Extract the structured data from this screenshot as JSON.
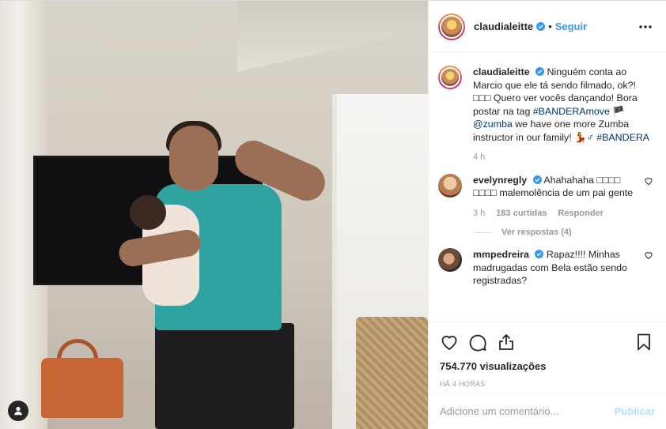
{
  "header": {
    "username": "claudialeitte",
    "separator": "•",
    "follow_label": "Seguir"
  },
  "caption": {
    "username": "claudialeitte",
    "text_1": "Ninguém conta ao Marcio que ele tá sendo filmado, ok?! □□□ Quero ver vocês dançando! Bora postar na tag ",
    "hashtag_1": "#BANDERAmove",
    "text_2": " 🏴 ",
    "mention": "@zumba",
    "text_3": " we have one more Zumba instructor in our family! 💃♂ ",
    "hashtag_2": "#BANDERA",
    "time": "4 h"
  },
  "comments": [
    {
      "username": "evelynregly",
      "text": "Ahahahaha □□□□ □□□□ malemolência de um pai gente",
      "time": "3 h",
      "likes": "183 curtidas",
      "reply_label": "Responder",
      "view_replies": "Ver respostas (4)"
    },
    {
      "username": "mmpedreira",
      "text": "Rapaz!!!! Minhas madrugadas com Bela estão sendo registradas?"
    }
  ],
  "stats": {
    "views": "754.770 visualizações",
    "time_ago": "HÁ 4 HORAS"
  },
  "composer": {
    "placeholder": "Adicione um comentário...",
    "post_label": "Publicar"
  },
  "colors": {
    "accent": "#3897f0",
    "hashtag": "#003569",
    "muted": "#999999"
  },
  "icons": [
    "verified-icon",
    "more-options-icon",
    "heart-icon",
    "comment-icon",
    "share-icon",
    "bookmark-icon",
    "user-tag-icon"
  ]
}
